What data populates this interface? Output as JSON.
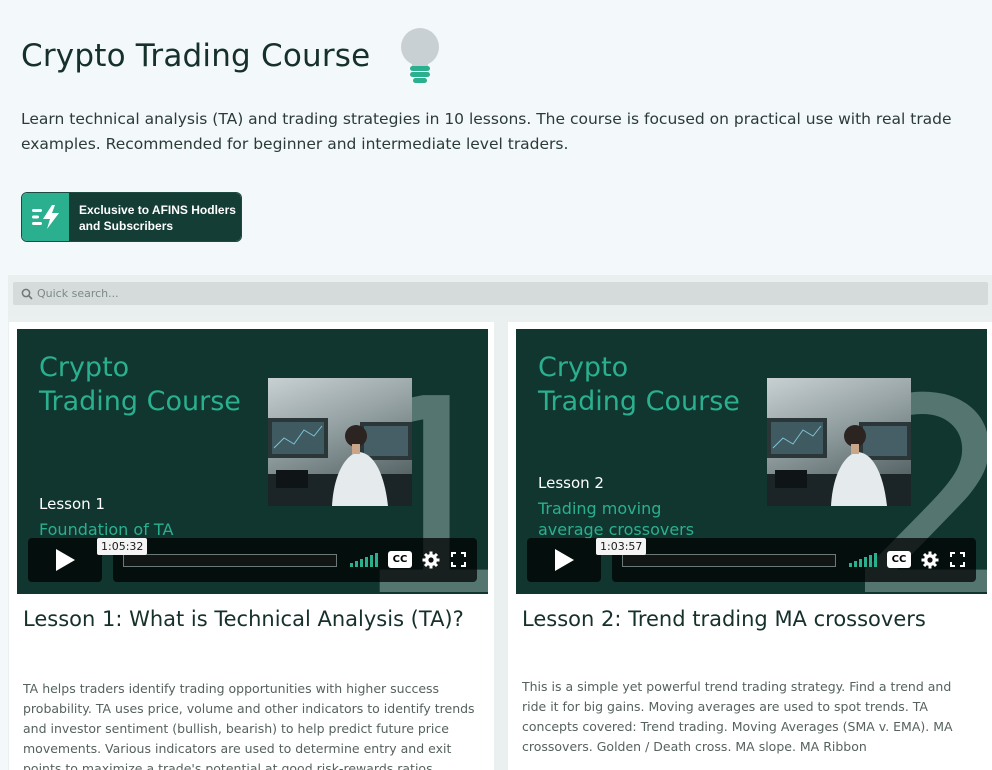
{
  "header": {
    "title": "Crypto Trading Course",
    "description": "Learn technical analysis (TA) and trading strategies in 10 lessons. The course is focused on practical use with real trade examples. Recommended for beginner and intermediate level traders.",
    "badge_line1": "Exclusive to AFINS Hodlers",
    "badge_line2": "and Subscribers",
    "icon": "lightbulb-icon"
  },
  "search": {
    "placeholder": "Quick search..."
  },
  "colors": {
    "accent": "#2bb08f",
    "dark_green": "#10362f",
    "title": "#16302b"
  },
  "cards": [
    {
      "video": {
        "course_line1": "Crypto",
        "course_line2": "Trading Course",
        "lesson": "Lesson 1",
        "topic_line1": "Foundation of TA",
        "topic_line2": "",
        "digit": "1",
        "duration": "1:05:32"
      },
      "title": "Lesson 1: What is Technical Analysis (TA)?",
      "description": "TA helps traders identify trading opportunities with higher success probability. TA uses price, volume and other indicators to identify trends and investor sentiment (bullish, bearish) to help predict future price movements. Various indicators are used to determine entry and exit points to maximize a trade's potential at good risk-rewards ratios."
    },
    {
      "video": {
        "course_line1": "Crypto",
        "course_line2": "Trading Course",
        "lesson": "Lesson 2",
        "topic_line1": "Trading moving",
        "topic_line2": "average crossovers",
        "digit": "2",
        "duration": "1:03:57"
      },
      "title": "Lesson 2: Trend trading MA crossovers",
      "description": "This is a simple yet powerful trend trading strategy. Find a trend and ride it for big gains. Moving averages are used to spot trends. TA concepts covered: Trend trading. Moving Averages (SMA v. EMA). MA crossovers. Golden / Death cross. MA slope. MA Ribbon"
    }
  ]
}
